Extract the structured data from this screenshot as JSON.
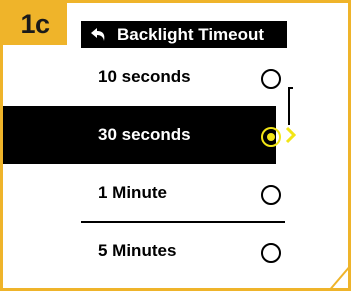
{
  "step": {
    "label": "1c"
  },
  "header": {
    "back_icon": "back-arrow-icon",
    "title": "Backlight Timeout"
  },
  "options": [
    {
      "label": "10 seconds",
      "selected": false
    },
    {
      "label": "30 seconds",
      "selected": true
    },
    {
      "label": "1 Minute",
      "selected": false
    },
    {
      "label": "5 Minutes",
      "selected": false
    }
  ],
  "colors": {
    "badge": "#efb42a",
    "frame": "#efb42a",
    "selected_background": "#000000",
    "selected_text": "#ffffff",
    "radio_selected": "#f2e516"
  },
  "icons": {
    "selected_indicator": "chevron-right-icon",
    "radio": "radio-button-icon"
  }
}
